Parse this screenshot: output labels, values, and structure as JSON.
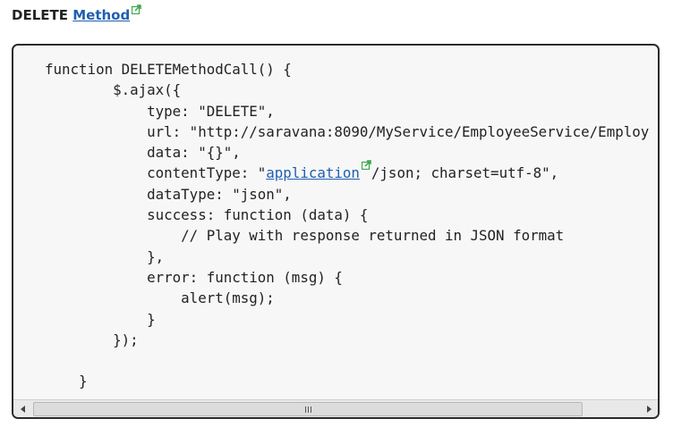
{
  "heading": {
    "prefix": "DELETE",
    "link": "Method",
    "icon": "external-link-icon"
  },
  "code": {
    "lines": [
      "function DELETEMethodCall() {",
      "        $.ajax({",
      "            type: \"DELETE\",",
      "            url: \"http://saravana:8090/MyService/EmployeeService/Employ",
      "            data: \"{}\",",
      {
        "before": "            contentType: \"",
        "link": "application",
        "after": "/json; charset=utf-8\","
      },
      "            dataType: \"json\",",
      "            success: function (data) {",
      "                // Play with response returned in JSON format",
      "            },",
      "            error: function (msg) {",
      "                alert(msg);",
      "            }",
      "        });",
      "",
      "    }"
    ]
  },
  "scrollbar": {
    "left_icon": "scroll-left-arrow-icon",
    "right_icon": "scroll-right-arrow-icon",
    "thumb_icon": "grip-icon"
  }
}
